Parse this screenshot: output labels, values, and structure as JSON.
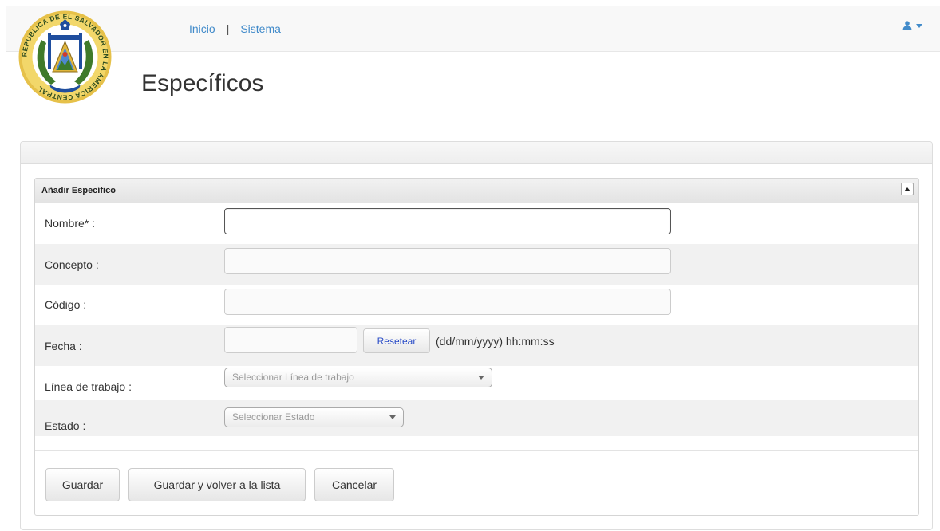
{
  "nav": {
    "links": [
      "Inicio",
      "Sistema"
    ],
    "separator": "|",
    "user_icon": "user-icon",
    "accent_color": "#428bca"
  },
  "logo": {
    "alt": "Escudo de El Salvador",
    "ring_text": "REPUBLICA DE EL SALVADOR EN LA AMERICA CENTRAL"
  },
  "page": {
    "title": "Específicos"
  },
  "form": {
    "box_title": "Añadir Específico",
    "fields": {
      "nombre": {
        "label": "Nombre* :",
        "value": ""
      },
      "concepto": {
        "label": "Concepto :",
        "value": ""
      },
      "codigo": {
        "label": "Código :",
        "value": ""
      },
      "fecha": {
        "label": "Fecha :",
        "value": "",
        "reset_label": "Resetear",
        "hint": "(dd/mm/yyyy) hh:mm:ss"
      },
      "linea": {
        "label": "Línea de trabajo :",
        "placeholder": "Seleccionar Línea de trabajo"
      },
      "estado": {
        "label": "Estado :",
        "placeholder": "Seleccionar Estado"
      }
    },
    "buttons": {
      "save": "Guardar",
      "save_return": "Guardar y volver a la lista",
      "cancel": "Cancelar"
    }
  }
}
